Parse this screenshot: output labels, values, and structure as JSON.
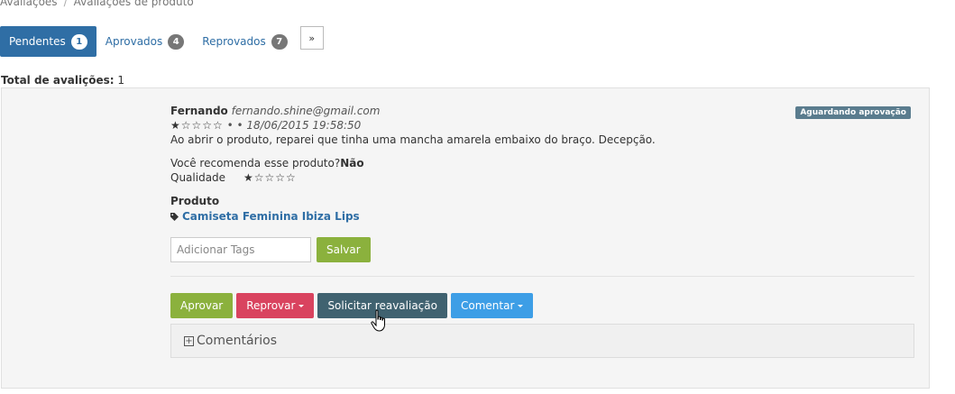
{
  "breadcrumb": [
    "Avaliações",
    "Avaliações de produto"
  ],
  "tabs": [
    {
      "label": "Pendentes",
      "count": "1",
      "active": true
    },
    {
      "label": "Aprovados",
      "count": "4",
      "active": false
    },
    {
      "label": "Reprovados",
      "count": "7",
      "active": false
    }
  ],
  "more_label": "»",
  "total": {
    "label": "Total de avalições:",
    "value": "1"
  },
  "review": {
    "author": "Fernando",
    "email": "fernando.shine@gmail.com",
    "rating_stars": "★☆☆☆☆",
    "date": "• • 18/06/2015 19:58:50",
    "status": "Aguardando aprovação",
    "comment": "Ao abrir o produto, reparei que tinha uma mancha amarela embaixo do braço. Decepção.",
    "recommend_question": "Você recomenda esse produto?",
    "recommend_answer": "Não",
    "quality_label": "Qualidade",
    "quality_stars": "★☆☆☆☆",
    "product_heading": "Produto",
    "product_name": "Camiseta Feminina Ibiza Lips"
  },
  "tags": {
    "placeholder": "Adicionar Tags",
    "save_label": "Salvar"
  },
  "actions": {
    "approve": "Aprovar",
    "reject": "Reprovar",
    "request_reevaluation": "Solicitar reavaliação",
    "comment": "Comentar"
  },
  "comments_label": "Comentários",
  "colors": {
    "primary": "#2f6ea5",
    "approve": "#8bb13d",
    "reject": "#d9435f",
    "request": "#406270",
    "comment": "#3d9ee6",
    "status": "#5a7c8e"
  }
}
